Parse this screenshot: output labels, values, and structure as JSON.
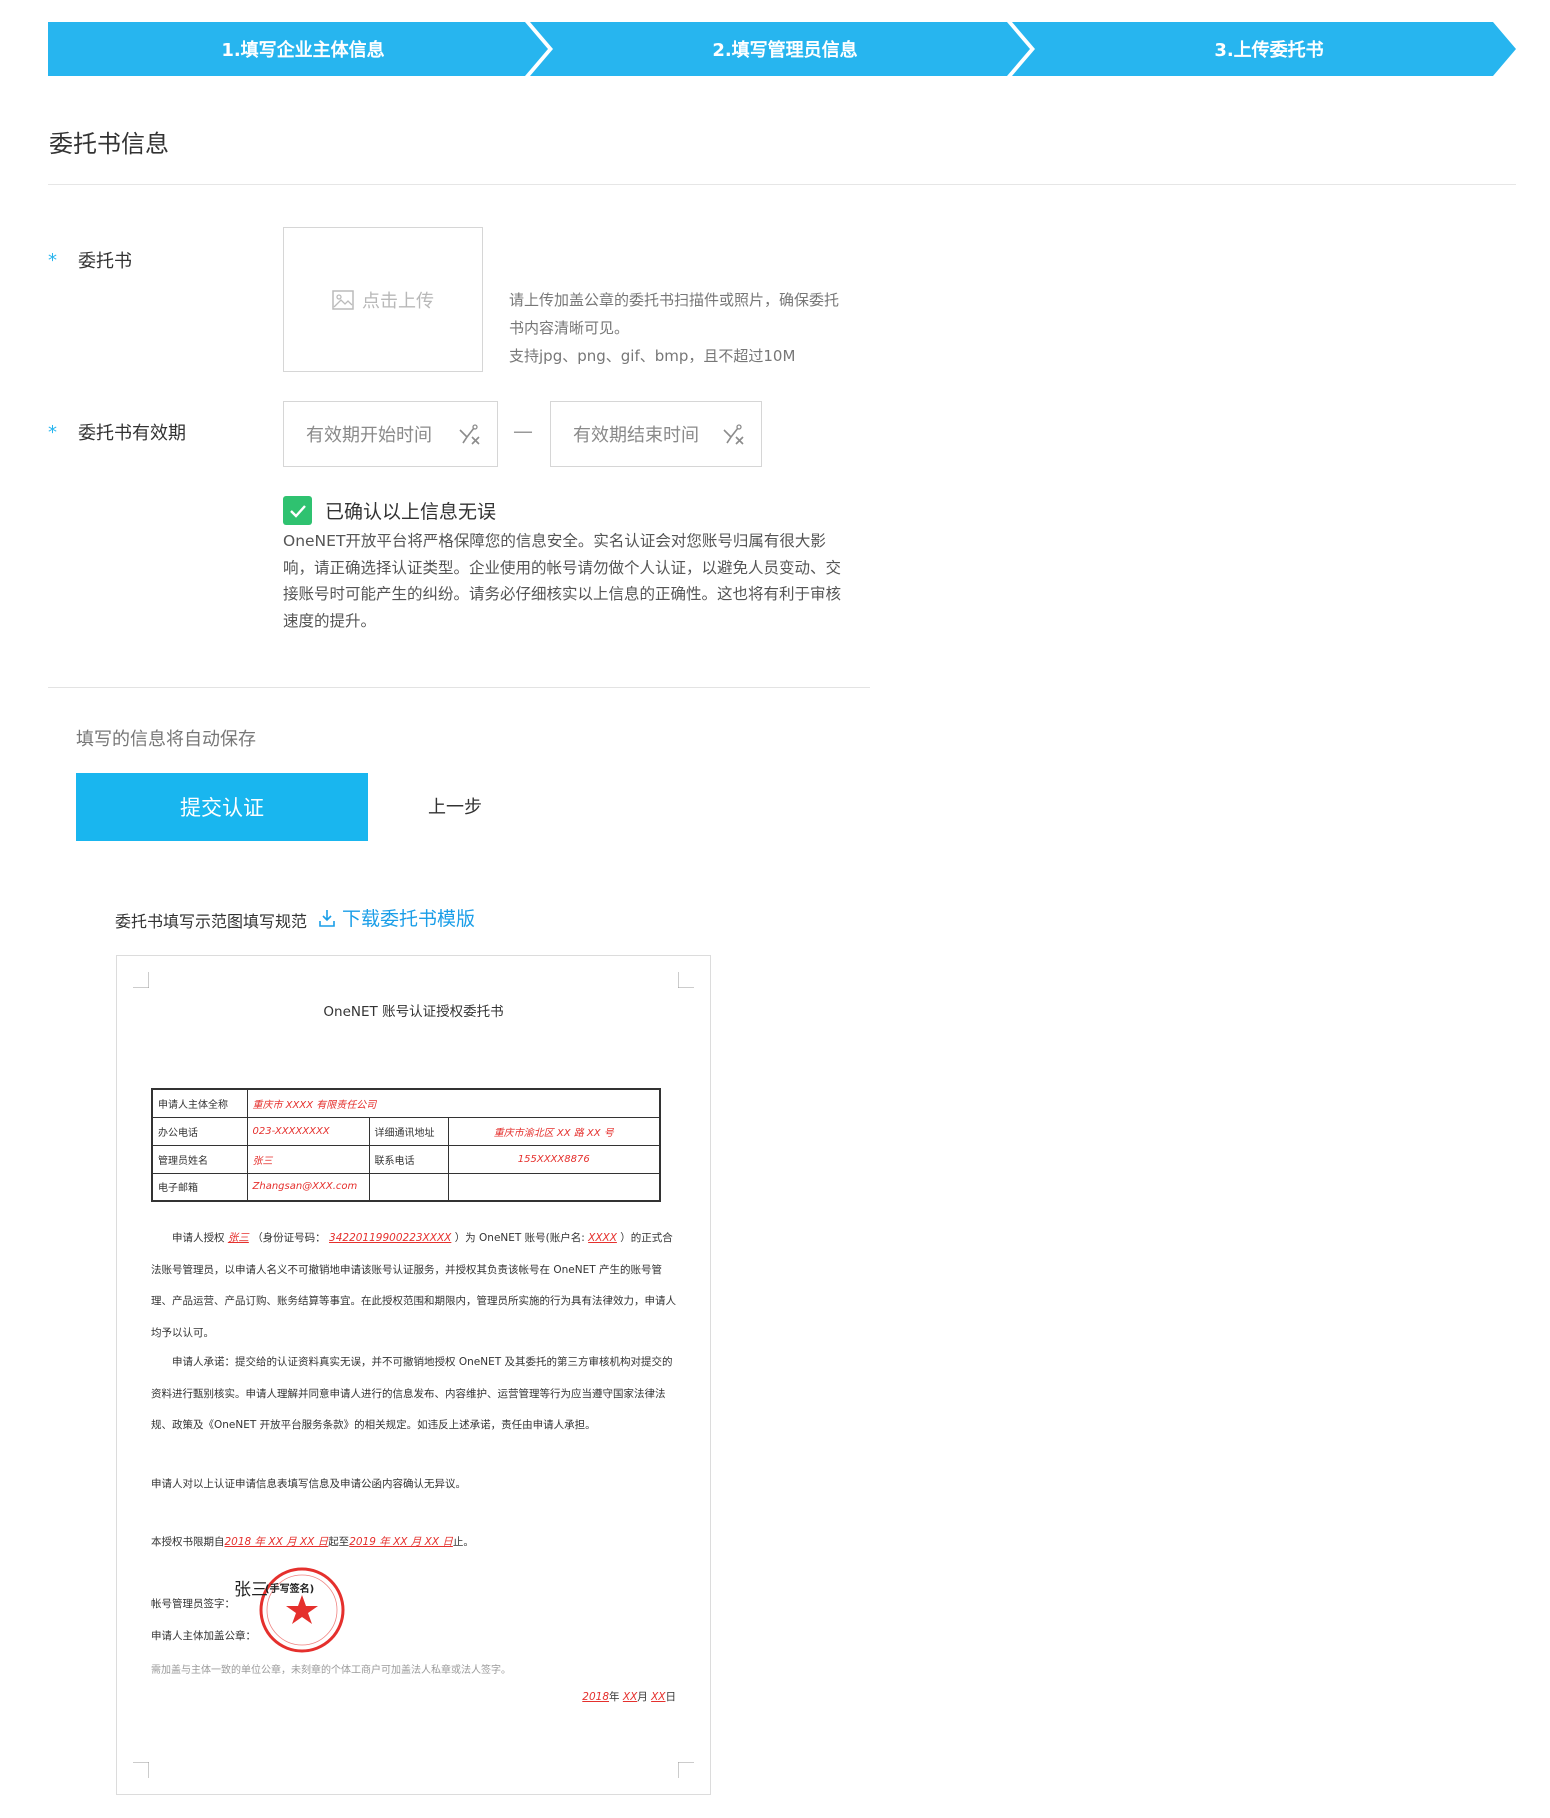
{
  "steps": {
    "step1": "1.填写企业主体信息",
    "step2": "2.填写管理员信息",
    "step3": "3.上传委托书"
  },
  "section_title": "委托书信息",
  "form": {
    "required_mark": "*",
    "letter_label": "委托书",
    "upload_text": "点击上传",
    "upload_hint_1": "请上传加盖公章的委托书扫描件或照片，确保委托书内容清晰可见。",
    "upload_hint_2": "支持jpg、png、gif、bmp，且不超过10M",
    "validity_label": "委托书有效期",
    "start_placeholder": "有效期开始时间",
    "end_placeholder": "有效期结束时间",
    "date_separator": "—",
    "confirm_label": "已确认以上信息无误",
    "confirm_checked": true,
    "notice": "OneNET开放平台将严格保障您的信息安全。实名认证会对您账号归属有很大影响，请正确选择认证类型。企业使用的帐号请勿做个人认证，以避免人员变动、交接账号时可能产生的纠纷。请务必仔细核实以上信息的正确性。这也将有利于审核速度的提升。"
  },
  "footer": {
    "autosave": "填写的信息将自动保存",
    "submit": "提交认证",
    "prev": "上一步"
  },
  "template": {
    "label": "委托书填写示范图填写规范",
    "download": "下载委托书模版"
  },
  "sample_doc": {
    "title": "OneNET 账号认证授权委托书",
    "table": {
      "applicant_label": "申请人主体全称",
      "applicant_value": "重庆市 XXXX 有限责任公司",
      "office_phone_label": "办公电话",
      "office_phone_value": "023-XXXXXXXX",
      "address_label": "详细通讯地址",
      "address_value": "重庆市渝北区 XX 路 XX 号",
      "admin_name_label": "管理员姓名",
      "admin_name_value": "张三",
      "contact_label": "联系电话",
      "contact_value": "155XXXX8876",
      "email_label": "电子邮箱",
      "email_value": "Zhangsan@XXX.com"
    },
    "para1_a": "申请人授权",
    "para1_name": "张三",
    "para1_b": "（身份证号码：",
    "para1_id": "34220119900223XXXX",
    "para1_c": "）为 OneNET 账号(账户名:",
    "para1_account": "XXXX",
    "para1_d": "）的正式合法账号管理员，以申请人名义不可撤销地申请该账号认证服务，并授权其负责该帐号在 OneNET 产生的账号管理、产品运营、产品订购、账务结算等事宜。在此授权范围和期限内，管理员所实施的行为具有法律效力，申请人均予以认可。",
    "para2": "申请人承诺：提交给的认证资料真实无误，并不可撤销地授权 OneNET 及其委托的第三方审核机构对提交的资料进行甄别核实。申请人理解并同意申请人进行的信息发布、内容维护、运营管理等行为应当遵守国家法律法规、政策及《OneNET 开放平台服务条款》的相关规定。如违反上述承诺，责任由申请人承担。",
    "para3": "申请人对以上认证申请信息表填写信息及申请公函内容确认无异议。",
    "period_a": "本授权书限期自",
    "period_start": "2018 年 XX 月 XX 日",
    "period_b": "起至",
    "period_end": "2019 年 XX 月 XX 日",
    "period_c": "止。",
    "sign_label": "帐号管理员签字：",
    "signature": "张三",
    "sign_note": "(手写签名)",
    "seal_label": "申请人主体加盖公章：",
    "seal_note": "需加盖与主体一致的单位公章，未刻章的个体工商户可加盖法人私章或法人签字。",
    "date_year": "2018",
    "date_year_unit": "年",
    "date_month": "XX",
    "date_month_unit": "月",
    "date_day": "XX",
    "date_day_unit": "日"
  },
  "colors": {
    "primary": "#27b5ef",
    "checkbox": "#2fc270",
    "link": "#1a9ee8",
    "seal_red": "#e5302d"
  },
  "icons": [
    "image-icon",
    "calendar-clear-icon",
    "check-icon",
    "download-icon"
  ]
}
